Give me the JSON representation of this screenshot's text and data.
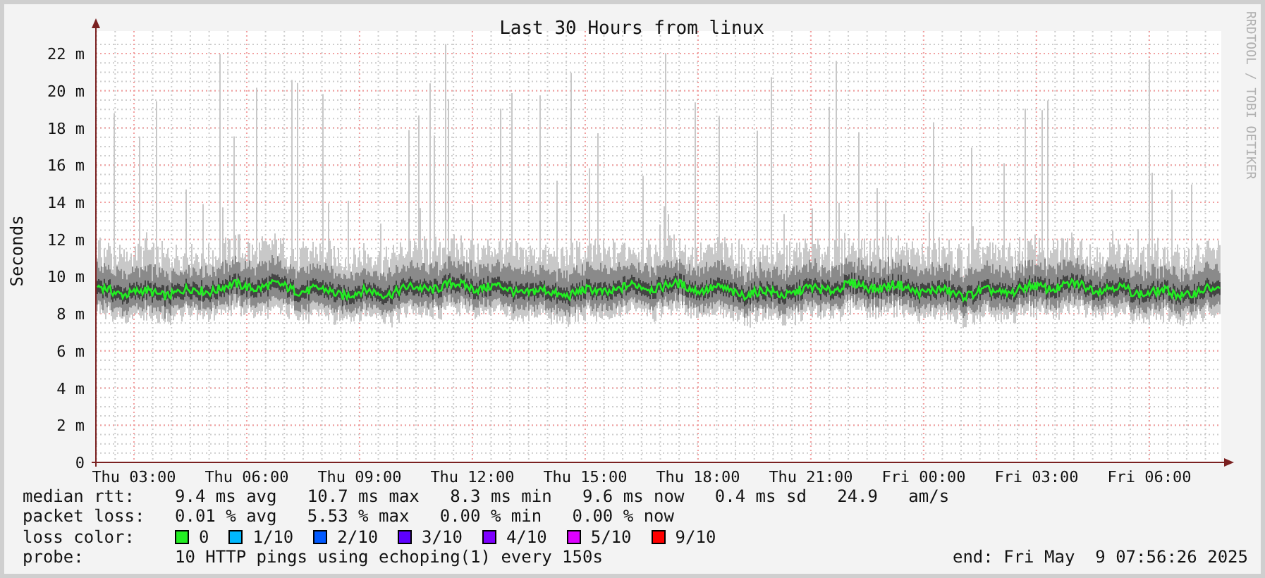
{
  "title": "Last 30 Hours from linux",
  "y_axis_label": "Seconds",
  "credit": "RRDTOOL / TOBI OETIKER",
  "y_ticks": [
    "22 m",
    "20 m",
    "18 m",
    "16 m",
    "14 m",
    "12 m",
    "10 m",
    "8 m",
    "6 m",
    "4 m",
    "2 m",
    "0"
  ],
  "x_ticks": [
    "Thu 03:00",
    "Thu 06:00",
    "Thu 09:00",
    "Thu 12:00",
    "Thu 15:00",
    "Thu 18:00",
    "Thu 21:00",
    "Fri 00:00",
    "Fri 03:00",
    "Fri 06:00"
  ],
  "median_rtt": {
    "label": "median rtt:",
    "values": "9.4 ms avg   10.7 ms max   8.3 ms min   9.6 ms now   0.4 ms sd   24.9   am/s"
  },
  "packet_loss": {
    "label": "packet loss:",
    "values": "0.01 % avg   5.53 % max   0.00 % min   0.00 % now"
  },
  "loss_color": {
    "label": "loss color:",
    "items": [
      {
        "label": "0",
        "color": "#22ee22"
      },
      {
        "label": "1/10",
        "color": "#00b8ff"
      },
      {
        "label": "2/10",
        "color": "#0059ff"
      },
      {
        "label": "3/10",
        "color": "#5e00ff"
      },
      {
        "label": "4/10",
        "color": "#7e00ff"
      },
      {
        "label": "5/10",
        "color": "#dd00ff"
      },
      {
        "label": "9/10",
        "color": "#ff0000"
      }
    ]
  },
  "probe": {
    "label": "probe:",
    "text": "10 HTTP pings using echoping(1) every 150s"
  },
  "end": "end: Fri May  9 07:56:26 2025"
}
